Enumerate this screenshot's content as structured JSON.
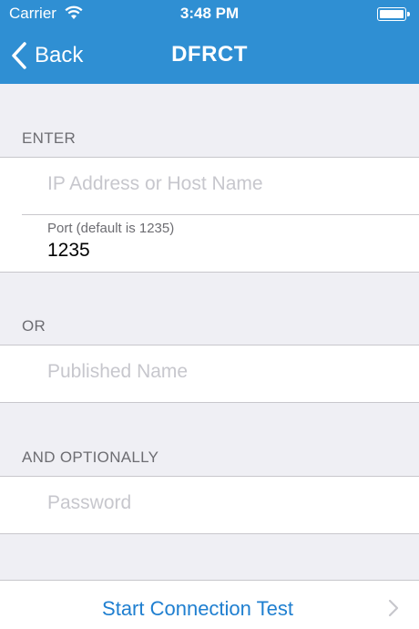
{
  "status_bar": {
    "carrier": "Carrier",
    "time": "3:48 PM",
    "wifi_icon": "wifi-icon",
    "battery_icon": "battery-icon"
  },
  "nav": {
    "back_label": "Back",
    "title": "DFRCT"
  },
  "sections": {
    "enter": {
      "header": "ENTER",
      "host_placeholder": "IP Address or Host Name",
      "host_value": "",
      "port_label": "Port (default is 1235)",
      "port_value": "1235"
    },
    "or": {
      "header": "OR",
      "published_placeholder": "Published Name",
      "published_value": ""
    },
    "optional": {
      "header": "AND OPTIONALLY",
      "password_placeholder": "Password",
      "password_value": ""
    }
  },
  "action": {
    "label": "Start Connection Test"
  },
  "colors": {
    "nav_background": "#2f8fd3",
    "accent": "#1f7fd0",
    "background": "#efeff4"
  }
}
